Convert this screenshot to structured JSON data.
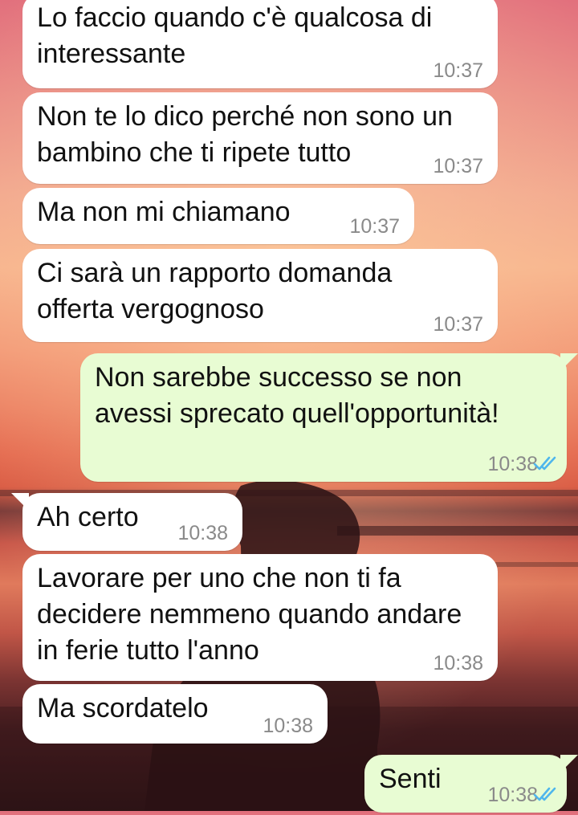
{
  "messages": [
    {
      "direction": "in",
      "text": "Lo faccio quando c'è qualcosa di\ninteressante",
      "time": "10:37"
    },
    {
      "direction": "in",
      "text": "Non te lo dico perché non sono un\nbambino che ti ripete tutto",
      "time": "10:37"
    },
    {
      "direction": "in",
      "text": "Ma non mi chiamano",
      "time": "10:37"
    },
    {
      "direction": "in",
      "text": "Ci sarà un rapporto domanda\nofferta vergognoso",
      "time": "10:37"
    },
    {
      "direction": "out",
      "text": "Non sarebbe successo se non\navessi sprecato quell'opportunità!",
      "time": "10:38",
      "status": "read"
    },
    {
      "direction": "in",
      "text": "Ah certo",
      "time": "10:38"
    },
    {
      "direction": "in",
      "text": "Lavorare per uno che non ti fa\ndecidere nemmeno quando andare\nin ferie tutto l'anno",
      "time": "10:38"
    },
    {
      "direction": "in",
      "text": "Ma scordatelo",
      "time": "10:38"
    },
    {
      "direction": "out",
      "text": "Senti",
      "time": "10:38",
      "status": "read"
    }
  ],
  "colors": {
    "incoming_bubble": "#ffffff",
    "outgoing_bubble": "#e8fcd3",
    "read_tick": "#4fb6ec",
    "timestamp": "#8a8a8a"
  }
}
